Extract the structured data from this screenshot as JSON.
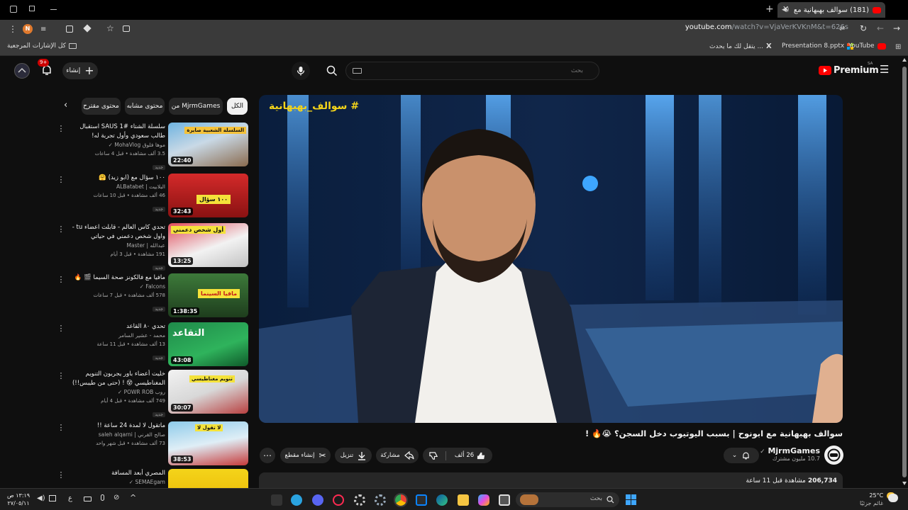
{
  "browser": {
    "tab": {
      "title": "(181) سوالف بهبهانية مع ابو...",
      "favicon": "youtube-icon"
    },
    "new_tab_label": "+",
    "url": {
      "host": "youtube.com",
      "path": "/watch?v=VjaVerKVKnM&t=626s"
    },
    "bookmarks": [
      {
        "label": "YouTube",
        "icon": "youtube-icon"
      },
      {
        "label": "Presentation 8.pptx",
        "icon": "office-icon"
      },
      {
        "label": "يتقل لك ما يحدث ...",
        "icon": "x-icon"
      },
      {
        "label": "كل الإشارات المرجعية",
        "icon": "folder-icon"
      }
    ],
    "profile_initial": "N"
  },
  "youtube": {
    "logo_text": "Premium",
    "logo_region": "SA",
    "search": {
      "placeholder": "بحث",
      "value": ""
    },
    "create_label": "إنشاء",
    "notifications_count": "9+"
  },
  "sidebar": {
    "chips": [
      {
        "label": "الكل",
        "active": true
      },
      {
        "label": "من MjrmGames",
        "active": false
      },
      {
        "label": "محتوى مشابه",
        "active": false
      },
      {
        "label": "محتوى مقترح",
        "active": false
      }
    ],
    "recommendations": [
      {
        "title": "سلسلة الشتاء #1 SAUS استقبال طالب سعودي وأول تجربة له!",
        "channel": "موها فلوق MohaVlog",
        "verified": true,
        "meta": "3.5 ألف مشاهدة • قبل 4 ساعات",
        "badge": "جديد",
        "duration": "22:40",
        "thumb_caption": "السلسلة الشعبية صايرة"
      },
      {
        "title": "١٠٠ سؤال مع (ابو زيد) 🤗",
        "channel": "البلابيت | ALBatabet",
        "verified": false,
        "meta": "46 ألف مشاهدة • قبل 10 ساعات",
        "badge": "جديد",
        "duration": "32:43",
        "thumb_caption": "١٠٠ سؤال"
      },
      {
        "title": "تحدي كاس العالم - قابلت اعضاء tu - واول شخص دعمني في حياتي",
        "channel": "عبدالله | Master",
        "verified": false,
        "meta": "191 مشاهدة • قبل 3 أيام",
        "badge": "جديد",
        "duration": "13:25",
        "thumb_caption": "أول شخص دعمني"
      },
      {
        "title": "مافيا مع فالكونز صحة السيما 🎬 🔥",
        "channel": "Falcons",
        "verified": true,
        "meta": "578 ألف مشاهدة • قبل 7 ساعات",
        "badge": "جديد",
        "duration": "1:38:35",
        "thumb_caption": "مافيا السينما"
      },
      {
        "title": "تحدي ٨٠ القاعد",
        "channel": "محمد - عشير السامر",
        "verified": false,
        "meta": "13 ألف مشاهدة • قبل 11 ساعة",
        "badge": "جديد",
        "duration": "43:08",
        "thumb_caption": "التقاعد"
      },
      {
        "title": "خليت أعضاء باور يجربون التنويم المغناطيسي 😵 ! (حتى من طيبس!!)",
        "channel": "روب POWR ROB",
        "verified": true,
        "meta": "749 ألف مشاهدة • قبل 4 أيام",
        "badge": "جديد",
        "duration": "30:07",
        "thumb_caption": "تنويم مغناطيسي"
      },
      {
        "title": "ماتقول لا لمدة 24 ساعة !!",
        "channel": "صالح القرني | saleh alqarni",
        "verified": false,
        "meta": "73 ألف مشاهدة • قبل شهر واحد",
        "badge": "جديد",
        "duration": "38:53",
        "thumb_caption": "لا تقول لا"
      },
      {
        "title": "المصري أبعد المسافة",
        "channel": "SEMAEgam",
        "verified": true,
        "meta": "",
        "badge": "",
        "duration": "",
        "thumb_caption": ""
      }
    ]
  },
  "player": {
    "overlay_hashtag": "# سوالف_بهبهانية"
  },
  "video": {
    "title": "سوالف بهبهانية مع ابونوح | بسبب اليوتيوب دخل السجن؟ 😭🔥 !",
    "channel_name": "MjrmGames",
    "channel_verified": true,
    "subscribers": "10.7 مليون مشترك",
    "likes": "26 ألف",
    "share_label": "مشاركة",
    "download_label": "تنزيل",
    "clip_label": "إنشاء مقطع",
    "views": "206,734",
    "views_suffix": "مشاهدة",
    "published": "قبل 11 ساعة"
  },
  "taskbar": {
    "search_placeholder": "بحث",
    "time": "١٣:١٩ ص",
    "date": "٢٧/٠٥/١١",
    "weather_temp": "25°C",
    "weather_desc": "غائم جزئيًا",
    "language": "ع"
  },
  "colors": {
    "yt_red": "#ff0000",
    "accent_blue": "#3ea6ff",
    "hashtag_yellow": "#f4d41a",
    "bg": "#0f0f0f"
  }
}
